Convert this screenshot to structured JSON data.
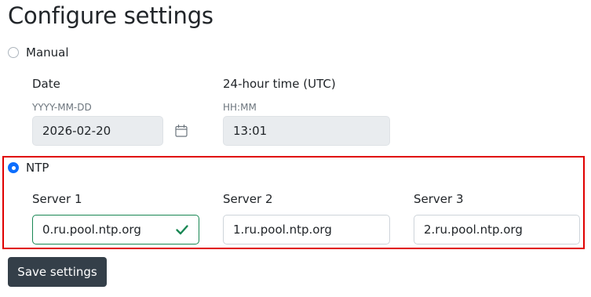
{
  "page": {
    "title": "Configure settings"
  },
  "manual": {
    "label": "Manual",
    "selected": false,
    "date": {
      "label": "Date",
      "format_hint": "YYYY-MM-DD",
      "value": "2026-02-20",
      "icon": "calendar-icon"
    },
    "time": {
      "label": "24-hour time (UTC)",
      "format_hint": "HH:MM",
      "value": "13:01"
    }
  },
  "ntp": {
    "label": "NTP",
    "selected": true,
    "servers": [
      {
        "label": "Server 1",
        "value": "0.ru.pool.ntp.org",
        "valid": true
      },
      {
        "label": "Server 2",
        "value": "1.ru.pool.ntp.org",
        "valid": false
      },
      {
        "label": "Server 3",
        "value": "2.ru.pool.ntp.org",
        "valid": false
      }
    ]
  },
  "actions": {
    "save_label": "Save settings"
  },
  "colors": {
    "accent": "#0d6efd",
    "valid": "#198754",
    "highlight_border": "#e00000",
    "button_bg": "#343f49"
  }
}
